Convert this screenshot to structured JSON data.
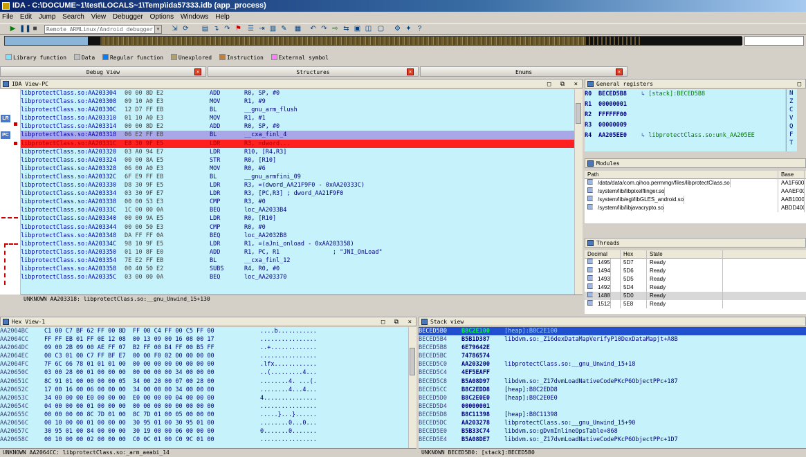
{
  "window": {
    "title": "IDA - C:\\DOCUME~1\\test\\LOCALS~1\\Temp\\ida57333.idb (app_process)"
  },
  "menu": [
    "File",
    "Edit",
    "Jump",
    "Search",
    "View",
    "Debugger",
    "Options",
    "Windows",
    "Help"
  ],
  "toolbar": {
    "debugger_select": "Remote ARMLinux/Android debugger"
  },
  "legend": [
    {
      "label": "Library function",
      "color": "#80e0ff"
    },
    {
      "label": "Data",
      "color": "#c0c0c0"
    },
    {
      "label": "Regular function",
      "color": "#0080ff"
    },
    {
      "label": "Unexplored",
      "color": "#b0a070"
    },
    {
      "label": "Instruction",
      "color": "#c08040"
    },
    {
      "label": "External symbol",
      "color": "#ff80ff"
    }
  ],
  "tabs": {
    "debug_view": "Debug View",
    "structures": "Structures",
    "enums": "Enums"
  },
  "ida_view": {
    "title": "IDA View-PC",
    "labels": {
      "lr": "LR",
      "pc": "PC"
    },
    "lines": [
      {
        "addr": "libprotectClass.so:AA203304",
        "bytes": "00 00 8D E2",
        "mn": "ADD",
        "ops": "R0, SP, #0"
      },
      {
        "addr": "libprotectClass.so:AA203308",
        "bytes": "09 10 A0 E3",
        "mn": "MOV",
        "ops": "R1, #9"
      },
      {
        "addr": "libprotectClass.so:AA20330C",
        "bytes": "12 D7 FF EB",
        "mn": "BL",
        "ops": "__gnu_arm_flush"
      },
      {
        "addr": "libprotectClass.so:AA203310",
        "bytes": "01 10 A0 E3",
        "mn": "MOV",
        "ops": "R1, #1"
      },
      {
        "addr": "libprotectClass.so:AA203314",
        "bytes": "00 00 8D E2",
        "mn": "ADD",
        "ops": "R0, SP, #0"
      },
      {
        "addr": "libprotectClass.so:AA203318",
        "bytes": "06 E2 FF EB",
        "mn": "BL",
        "ops": "__cxa_finl_4"
      },
      {
        "addr": "libprotectClass.so:AA20331C",
        "bytes": "E8 30 9F E5",
        "mn": "LDR",
        "ops": "R3, =dword..."
      },
      {
        "addr": "libprotectClass.so:AA203320",
        "bytes": "03 A0 94 E7",
        "mn": "LDR",
        "ops": "R10, [R4,R3]"
      },
      {
        "addr": "libprotectClass.so:AA203324",
        "bytes": "00 00 8A E5",
        "mn": "STR",
        "ops": "R0, [R10]"
      },
      {
        "addr": "libprotectClass.so:AA203328",
        "bytes": "06 00 A0 E3",
        "mn": "MOV",
        "ops": "R0, #6"
      },
      {
        "addr": "libprotectClass.so:AA20332C",
        "bytes": "6F E9 FF EB",
        "mn": "BL",
        "ops": "__gnu_armfini_09"
      },
      {
        "addr": "libprotectClass.so:AA203330",
        "bytes": "D8 30 9F E5",
        "mn": "LDR",
        "ops": "R3, =(dword_AA21F9F0 - 0xAA20333C)"
      },
      {
        "addr": "libprotectClass.so:AA203334",
        "bytes": "03 30 9F E7",
        "mn": "LDR",
        "ops": "R3, [PC,R3] ; dword_AA21F9F0"
      },
      {
        "addr": "libprotectClass.so:AA203338",
        "bytes": "00 00 53 E3",
        "mn": "CMP",
        "ops": "R3, #0"
      },
      {
        "addr": "libprotectClass.so:AA20333C",
        "bytes": "1C 00 00 0A",
        "mn": "BEQ",
        "ops": "loc_AA2033B4"
      },
      {
        "addr": "libprotectClass.so:AA203340",
        "bytes": "00 00 9A E5",
        "mn": "LDR",
        "ops": "R0, [R10]"
      },
      {
        "addr": "libprotectClass.so:AA203344",
        "bytes": "00 00 50 E3",
        "mn": "CMP",
        "ops": "R0, #0"
      },
      {
        "addr": "libprotectClass.so:AA203348",
        "bytes": "DA FF FF 0A",
        "mn": "BEQ",
        "ops": "loc_AA2032B8"
      },
      {
        "addr": "libprotectClass.so:AA20334C",
        "bytes": "98 10 9F E5",
        "mn": "LDR",
        "ops": "R1, =(aJni_onload - 0xAA203358)"
      },
      {
        "addr": "libprotectClass.so:AA203350",
        "bytes": "01 10 8F E0",
        "mn": "ADD",
        "ops": "R1, PC, R1               ; \"JNI_OnLoad\""
      },
      {
        "addr": "libprotectClass.so:AA203354",
        "bytes": "7E E2 FF EB",
        "mn": "BL",
        "ops": "__cxa_finl_12"
      },
      {
        "addr": "libprotectClass.so:AA203358",
        "bytes": "00 40 50 E2",
        "mn": "SUBS",
        "ops": "R4, R0, #0"
      },
      {
        "addr": "libprotectClass.so:AA20335C",
        "bytes": "03 00 00 0A",
        "mn": "BEQ",
        "ops": "loc_AA203370"
      }
    ],
    "status": "UNKNOWN AA203318: libprotectClass.so:__gnu_Unwind_15+130"
  },
  "registers": {
    "title": "General registers",
    "rows": [
      {
        "name": "R0",
        "value": "BECED5B8",
        "desc": "[stack]:BECED5B8"
      },
      {
        "name": "R1",
        "value": "00000001",
        "desc": ""
      },
      {
        "name": "R2",
        "value": "FFFFFF00",
        "desc": ""
      },
      {
        "name": "R3",
        "value": "00000009",
        "desc": ""
      },
      {
        "name": "R4",
        "value": "AA205EE0",
        "desc": "libprotectClass.so:unk_AA205EE"
      }
    ],
    "flags": [
      "N",
      "Z",
      "C",
      "V",
      "Q",
      "F",
      "T"
    ]
  },
  "modules": {
    "title": "Modules",
    "headers": [
      "Path",
      "Base"
    ],
    "rows": [
      {
        "path": "/data/data/com.qihoo.permmgr/files/libprotectClass.so",
        "base": "AA1F600"
      },
      {
        "path": "/system/lib/libpixelflinger.so",
        "base": "AAAEF00"
      },
      {
        "path": "/system/lib/egl/libGLES_android.so",
        "base": "AAB1000"
      },
      {
        "path": "/system/lib/libjavacrypto.so",
        "base": "ABDD400"
      }
    ]
  },
  "threads": {
    "title": "Threads",
    "headers": [
      "Decimal",
      "Hex",
      "State"
    ],
    "rows": [
      {
        "dec": "1495",
        "hex": "5D7",
        "state": "Ready"
      },
      {
        "dec": "1494",
        "hex": "5D6",
        "state": "Ready"
      },
      {
        "dec": "1493",
        "hex": "5D5",
        "state": "Ready"
      },
      {
        "dec": "1492",
        "hex": "5D4",
        "state": "Ready"
      },
      {
        "dec": "1488",
        "hex": "5D0",
        "state": "Ready"
      },
      {
        "dec": "1512",
        "hex": "5E8",
        "state": "Ready"
      }
    ]
  },
  "hex_view": {
    "title": "Hex View-1",
    "rows": [
      {
        "addr": "AA2064BC",
        "bytes": "C1 00 C7 BF 62 FF 00 8D  FF 00 C4 FF 00 C5 FF 00",
        "ascii": "....b..........."
      },
      {
        "addr": "AA2064CC",
        "bytes": "FF FF EB 01 FF 0E 12 08  00 13 09 00 16 08 00 17",
        "ascii": "................"
      },
      {
        "addr": "AA2064DC",
        "bytes": "09 00 2B 09 00 AE FF 07  B2 FF 00 B4 FF 00 B5 FF",
        "ascii": "..+............."
      },
      {
        "addr": "AA2064EC",
        "bytes": "00 C3 01 00 C7 FF BF E7  00 00 F0 02 00 00 00 00",
        "ascii": "................"
      },
      {
        "addr": "AA2064FC",
        "bytes": "7F 6C 66 78 01 01 01 00  00 00 00 00 00 00 00 00",
        "ascii": ".lfx............"
      },
      {
        "addr": "AA20650C",
        "bytes": "03 00 28 00 01 00 00 00  00 00 00 00 34 00 00 00",
        "ascii": "..(.........4..."
      },
      {
        "addr": "AA20651C",
        "bytes": "8C 91 01 00 00 00 00 05  34 00 20 00 07 00 28 00",
        "ascii": "........4. ...(."
      },
      {
        "addr": "AA20652C",
        "bytes": "17 00 16 00 06 00 00 00  34 00 00 00 34 00 00 00",
        "ascii": "........4...4..."
      },
      {
        "addr": "AA20653C",
        "bytes": "34 00 00 00 E0 00 00 00  E0 00 00 00 04 00 00 00",
        "ascii": "4..............."
      },
      {
        "addr": "AA20654C",
        "bytes": "04 00 00 00 01 00 00 00  00 00 00 00 00 00 00 00",
        "ascii": "................"
      },
      {
        "addr": "AA20655C",
        "bytes": "00 00 00 00 8C 7D 01 00  8C 7D 01 00 05 00 00 00",
        "ascii": ".....}...}......"
      },
      {
        "addr": "AA20656C",
        "bytes": "00 10 00 00 01 00 00 00  30 95 01 00 30 95 01 00",
        "ascii": "........0...0..."
      },
      {
        "addr": "AA20657C",
        "bytes": "30 95 01 00 84 00 00 00  30 19 00 00 06 00 00 00",
        "ascii": "0.......0......."
      },
      {
        "addr": "AA20658C",
        "bytes": "00 10 00 00 02 00 00 00  C0 0C 01 00 C0 9C 01 00",
        "ascii": "................"
      }
    ],
    "status": "UNKNOWN AA2064CC: libprotectClass.so:_arm_aeabi_14"
  },
  "stack_view": {
    "title": "Stack view",
    "rows": [
      {
        "addr": "BECED5B0",
        "value": "B8C2E100",
        "desc": "[heap]:B8C2E100"
      },
      {
        "addr": "BECED5B4",
        "value": "B5B1D387",
        "desc": "libdvm.so:_Z16dexDataMapVerifyP10DexDataMapjt+A8B"
      },
      {
        "addr": "BECED5B8",
        "value": "6E79642E",
        "desc": ""
      },
      {
        "addr": "BECED5BC",
        "value": "74786574",
        "desc": ""
      },
      {
        "addr": "BECED5C0",
        "value": "AA203200",
        "desc": "libprotectClass.so:__gnu_Unwind_15+18"
      },
      {
        "addr": "BECED5C4",
        "value": "4EF5EAFF",
        "desc": ""
      },
      {
        "addr": "BECED5C8",
        "value": "B5A08D97",
        "desc": "libdvm.so:_Z17dvmLoadNativeCodePKcP6ObjectPPc+187"
      },
      {
        "addr": "BECED5CC",
        "value": "B8C2EDD8",
        "desc": "[heap]:B8C2EDD8"
      },
      {
        "addr": "BECED5D0",
        "value": "B8C2E0E0",
        "desc": "[heap]:B8C2E0E0"
      },
      {
        "addr": "BECED5D4",
        "value": "00000001",
        "desc": ""
      },
      {
        "addr": "BECED5D8",
        "value": "B8C11398",
        "desc": "[heap]:B8C11398"
      },
      {
        "addr": "BECED5DC",
        "value": "AA203278",
        "desc": "libprotectClass.so:__gnu_Unwind_15+90"
      },
      {
        "addr": "BECED5E0",
        "value": "B5B33C74",
        "desc": "libdvm.so:gDvmInlineOpsTable+868"
      },
      {
        "addr": "BECED5E4",
        "value": "B5A08DE7",
        "desc": "libdvm.so:_Z17dvmLoadNativeCodePKcP6ObjectPPc+1D7"
      }
    ],
    "status": "UNKNOWN BECED5B0: [stack]:BECED5B0"
  }
}
